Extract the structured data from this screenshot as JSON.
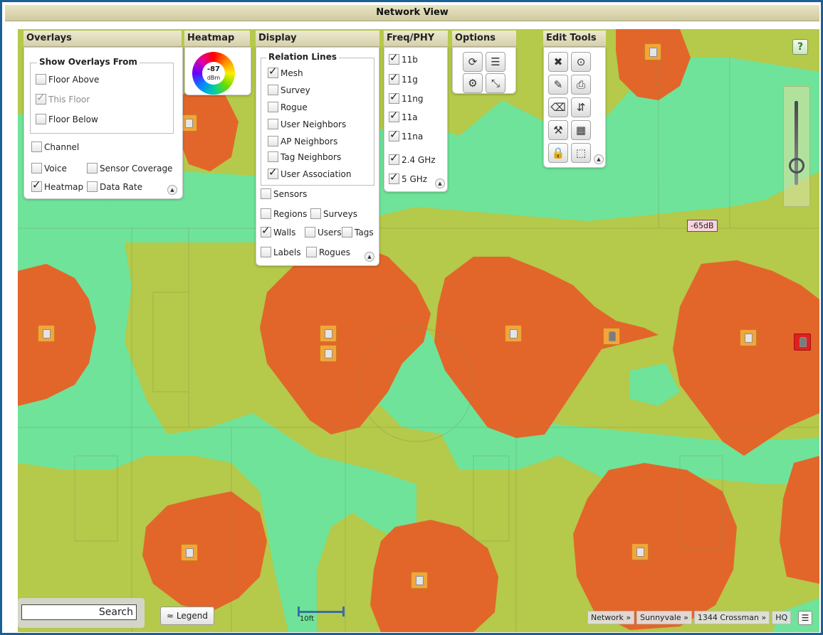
{
  "title": "Network View",
  "overlays": {
    "header": "Overlays",
    "group_title": "Show Overlays From",
    "floor_above": "Floor Above",
    "this_floor": "This Floor",
    "floor_below": "Floor Below",
    "channel": "Channel",
    "voice": "Voice",
    "sensor_coverage": "Sensor Coverage",
    "heatmap": "Heatmap",
    "data_rate": "Data Rate"
  },
  "heatmap": {
    "header": "Heatmap",
    "value": "-87",
    "unit": "dBm"
  },
  "display": {
    "header": "Display",
    "group_title": "Relation Lines",
    "mesh": "Mesh",
    "survey": "Survey",
    "rogue": "Rogue",
    "user_neighbors": "User Neighbors",
    "ap_neighbors": "AP Neighbors",
    "tag_neighbors": "Tag Neighbors",
    "user_association": "User Association",
    "sensors": "Sensors",
    "regions": "Regions",
    "surveys": "Surveys",
    "walls": "Walls",
    "users": "Users",
    "tags": "Tags",
    "labels": "Labels",
    "rogues": "Rogues"
  },
  "freq": {
    "header": "Freq/PHY",
    "items": [
      "11b",
      "11g",
      "11ng",
      "11a",
      "11na",
      "2.4 GHz",
      "5 GHz"
    ]
  },
  "options": {
    "header": "Options"
  },
  "edit_tools": {
    "header": "Edit Tools"
  },
  "map_labels": {
    "tooltip": "-65dB",
    "scale": "10ft",
    "help": "?"
  },
  "search": {
    "label": "Search"
  },
  "legend": {
    "label": "≈ Legend"
  },
  "breadcrumb": [
    "Network »",
    "Sunnyvale »",
    "1344 Crossman »",
    "HQ"
  ],
  "colors": {
    "frame": "#1b5f97",
    "strong_signal": "#e2662a",
    "medium_signal": "#b5c94a",
    "weak_signal": "#6fe39a"
  }
}
